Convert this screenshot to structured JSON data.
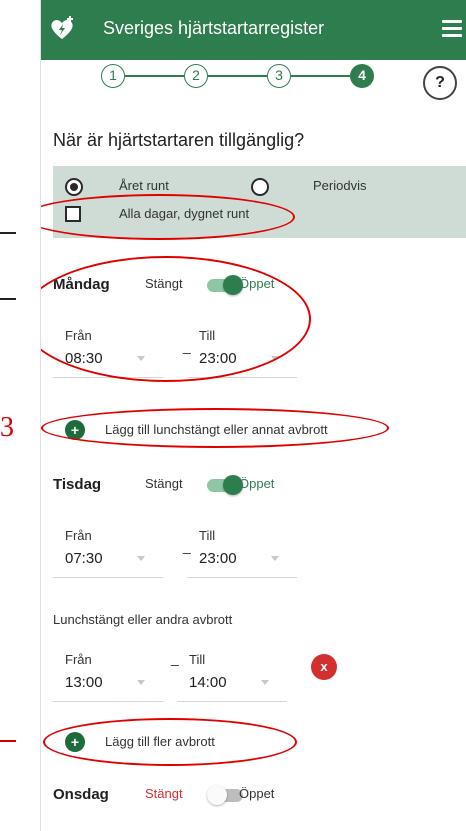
{
  "header": {
    "title": "Sveriges hjärtstartarregister",
    "logo_icon": "heart-defibrillator-icon",
    "menu_icon": "hamburger-menu-icon"
  },
  "stepper": {
    "steps": [
      "1",
      "2",
      "3",
      "4"
    ],
    "active_step": "4",
    "help_label": "?"
  },
  "question": "När är hjärtstartaren tillgänglig?",
  "availability": {
    "year_round": "Året runt",
    "periodic": "Periodvis",
    "all_days": "Alla dagar, dygnet runt",
    "year_round_selected": true
  },
  "days": {
    "monday": {
      "name": "Måndag",
      "closed": "Stängt",
      "open": "Öppet",
      "is_open": true,
      "from_label": "Från",
      "from_value": "08:30",
      "dash": "_",
      "to_label": "Till",
      "to_value": "23:00",
      "add_label": "Lägg till lunchstängt eller annat avbrott"
    },
    "tuesday": {
      "name": "Tisdag",
      "closed": "Stängt",
      "open": "Öppet",
      "is_open": true,
      "from_label": "Från",
      "from_value": "07:30",
      "dash": "_",
      "to_label": "Till",
      "to_value": "23:00",
      "break_heading": "Lunchstängt eller andra avbrott",
      "break_from_label": "Från",
      "break_from_value": "13:00",
      "break_dash": "_",
      "break_to_label": "Till",
      "break_to_value": "14:00",
      "remove_label": "x",
      "add_more_label": "Lägg till fler avbrott"
    },
    "wednesday": {
      "name": "Onsdag",
      "closed": "Stängt",
      "open": "Öppet",
      "is_open": false
    }
  },
  "colors": {
    "brand_green": "#2e7d4f",
    "panel": "#cfdcd6",
    "remove_red": "#d32f2f",
    "annotation_red": "#e00000"
  },
  "add_icon": "plus-icon"
}
